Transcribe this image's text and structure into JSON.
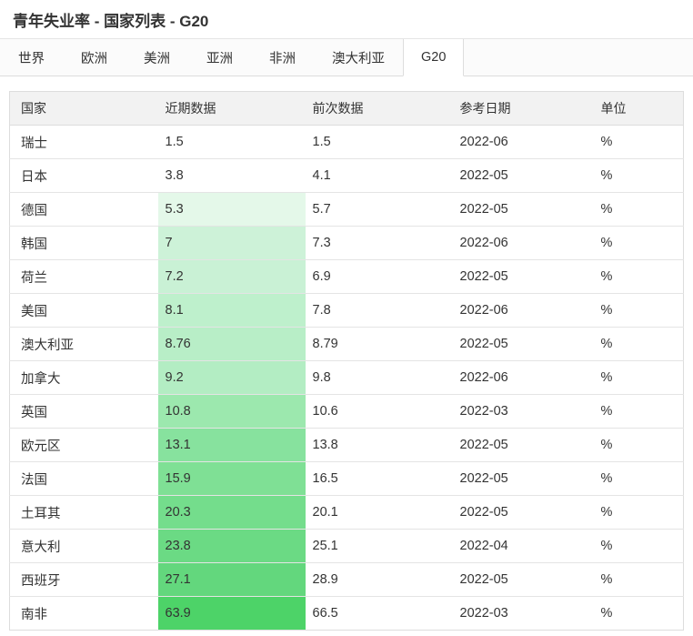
{
  "page": {
    "title": "青年失业率 - 国家列表 - G20"
  },
  "tabs": {
    "items": [
      {
        "label": "世界",
        "active": false
      },
      {
        "label": "欧洲",
        "active": false
      },
      {
        "label": "美洲",
        "active": false
      },
      {
        "label": "亚洲",
        "active": false
      },
      {
        "label": "非洲",
        "active": false
      },
      {
        "label": "澳大利亚",
        "active": false
      },
      {
        "label": "G20",
        "active": true
      }
    ]
  },
  "table": {
    "columns": [
      "国家",
      "近期数据",
      "前次数据",
      "参考日期",
      "单位"
    ],
    "rows": [
      {
        "country": "瑞士",
        "latest": "1.5",
        "previous": "1.5",
        "date": "2022-06",
        "unit": "%",
        "latest_bg": ""
      },
      {
        "country": "日本",
        "latest": "3.8",
        "previous": "4.1",
        "date": "2022-05",
        "unit": "%",
        "latest_bg": ""
      },
      {
        "country": "德国",
        "latest": "5.3",
        "previous": "5.7",
        "date": "2022-05",
        "unit": "%",
        "latest_bg": "#e4f8e9"
      },
      {
        "country": "韩国",
        "latest": "7",
        "previous": "7.3",
        "date": "2022-06",
        "unit": "%",
        "latest_bg": "#cdf2d8"
      },
      {
        "country": "荷兰",
        "latest": "7.2",
        "previous": "6.9",
        "date": "2022-05",
        "unit": "%",
        "latest_bg": "#c9f1d5"
      },
      {
        "country": "美国",
        "latest": "8.1",
        "previous": "7.8",
        "date": "2022-06",
        "unit": "%",
        "latest_bg": "#bef0cc"
      },
      {
        "country": "澳大利亚",
        "latest": "8.76",
        "previous": "8.79",
        "date": "2022-05",
        "unit": "%",
        "latest_bg": "#b8eec7"
      },
      {
        "country": "加拿大",
        "latest": "9.2",
        "previous": "9.8",
        "date": "2022-06",
        "unit": "%",
        "latest_bg": "#b3edc3"
      },
      {
        "country": "英国",
        "latest": "10.8",
        "previous": "10.6",
        "date": "2022-03",
        "unit": "%",
        "latest_bg": "#9ce8ae"
      },
      {
        "country": "欧元区",
        "latest": "13.1",
        "previous": "13.8",
        "date": "2022-05",
        "unit": "%",
        "latest_bg": "#87e29e"
      },
      {
        "country": "法国",
        "latest": "15.9",
        "previous": "16.5",
        "date": "2022-05",
        "unit": "%",
        "latest_bg": "#7fe095"
      },
      {
        "country": "土耳其",
        "latest": "20.3",
        "previous": "20.1",
        "date": "2022-05",
        "unit": "%",
        "latest_bg": "#74dd8c"
      },
      {
        "country": "意大利",
        "latest": "23.8",
        "previous": "25.1",
        "date": "2022-04",
        "unit": "%",
        "latest_bg": "#6bda84"
      },
      {
        "country": "西班牙",
        "latest": "27.1",
        "previous": "28.9",
        "date": "2022-05",
        "unit": "%",
        "latest_bg": "#63d77d"
      },
      {
        "country": "南非",
        "latest": "63.9",
        "previous": "66.5",
        "date": "2022-03",
        "unit": "%",
        "latest_bg": "#4dd368"
      }
    ]
  },
  "colors": {
    "accent_green_full": "#4dd368",
    "header_bg": "#f2f2f2",
    "border": "#dddddd",
    "tabbar_bg": "#fbfbfb"
  }
}
